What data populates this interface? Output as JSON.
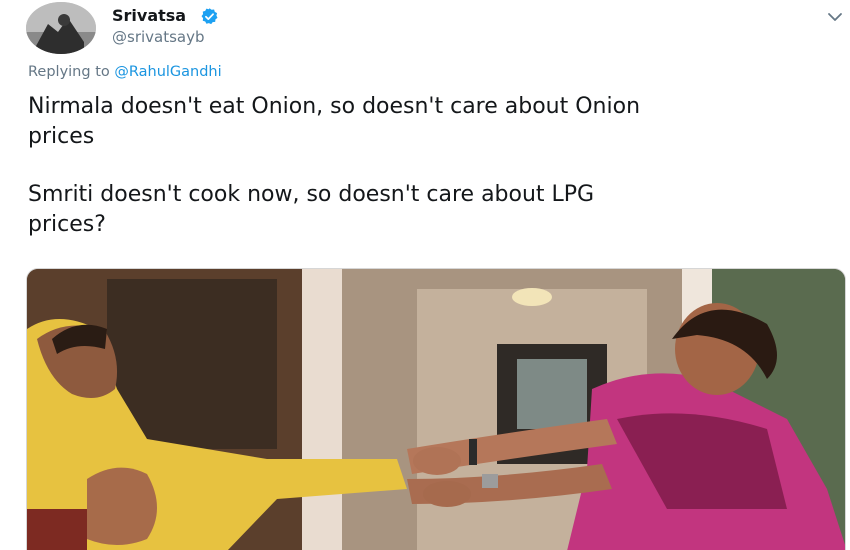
{
  "author": {
    "display_name": "Srivatsa",
    "handle": "@srivatsayb",
    "verified": true
  },
  "reply": {
    "prefix": "Replying to",
    "mention": "@RahulGandhi"
  },
  "tweet": {
    "line1": "Nirmala doesn't eat Onion, so doesn't care about Onion",
    "line2": "prices",
    "line3": "Smriti doesn't cook now, so doesn't care about LPG",
    "line4": "prices?"
  },
  "colors": {
    "link": "#1b95e0",
    "secondary_text": "#657786",
    "verified_badge": "#1da1f2"
  },
  "icons": {
    "verified": "verified-badge-icon",
    "more": "chevron-down-icon"
  }
}
